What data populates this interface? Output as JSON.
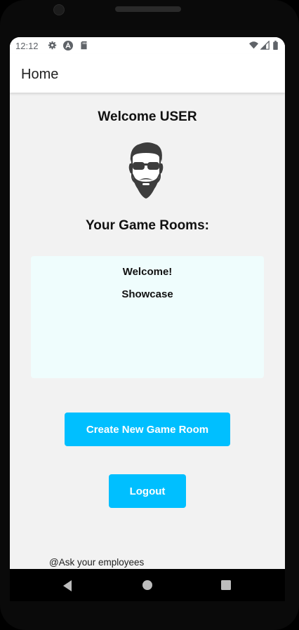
{
  "status_bar": {
    "time": "12:12",
    "left_icons": [
      "gear-icon",
      "a-circle-icon",
      "sd-card-icon"
    ],
    "right_icons": [
      "wifi-icon",
      "signal-icon",
      "battery-icon"
    ]
  },
  "app_bar": {
    "title": "Home"
  },
  "main": {
    "welcome": "Welcome USER",
    "avatar_icon": "bearded-man-sunglasses-avatar",
    "rooms_heading": "Your Game Rooms:",
    "rooms": [
      "Welcome!",
      "Showcase"
    ],
    "create_button": "Create New Game Room",
    "logout_button": "Logout",
    "footer": "@Ask your employees"
  },
  "nav_bar": {
    "icons": [
      "back-icon",
      "home-icon",
      "recents-icon"
    ]
  },
  "colors": {
    "accent": "#00bfff",
    "background": "#f2f2f2",
    "rooms_box": "#effdfd",
    "app_bar": "#ffffff"
  }
}
